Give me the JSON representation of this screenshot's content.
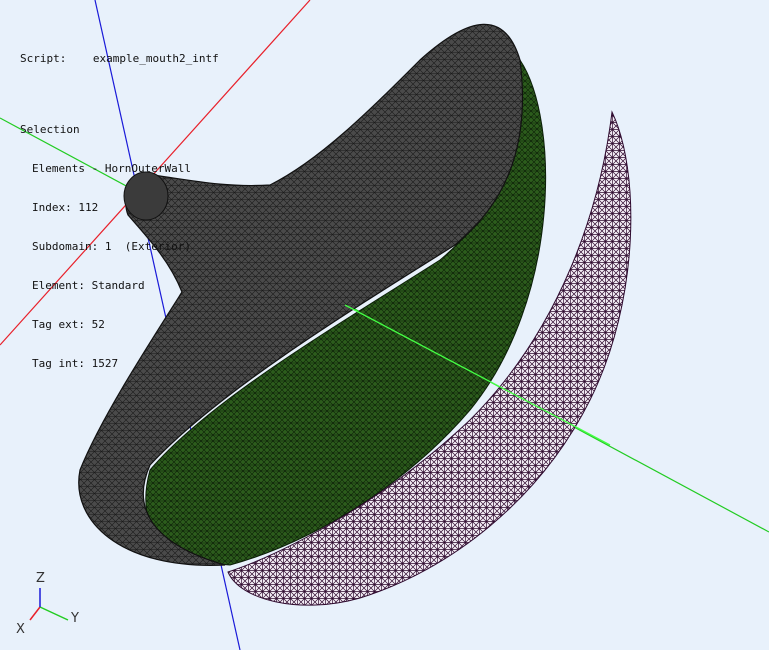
{
  "script": {
    "label": "Script:",
    "value": "example_mouth2_intf"
  },
  "selection": {
    "heading": "Selection",
    "elements": "Elements - HornOuterWall",
    "index": "Index: 112",
    "subdomain": "Subdomain: 1  (Exterior)",
    "element": "Element: Standard",
    "tag_ext": "Tag ext: 52",
    "tag_int": "Tag int: 1527"
  },
  "triad": {
    "x": "X",
    "y": "Y",
    "z": "Z"
  },
  "colors": {
    "background": "#e8f1fb",
    "axis_red": "#e8202a",
    "axis_blue": "#1a1ad8",
    "axis_green": "#22cc22",
    "mesh_outer": "#3a3a3a",
    "mesh_inner": "#1f4a14",
    "mesh_wire": "#3a0d3a"
  }
}
